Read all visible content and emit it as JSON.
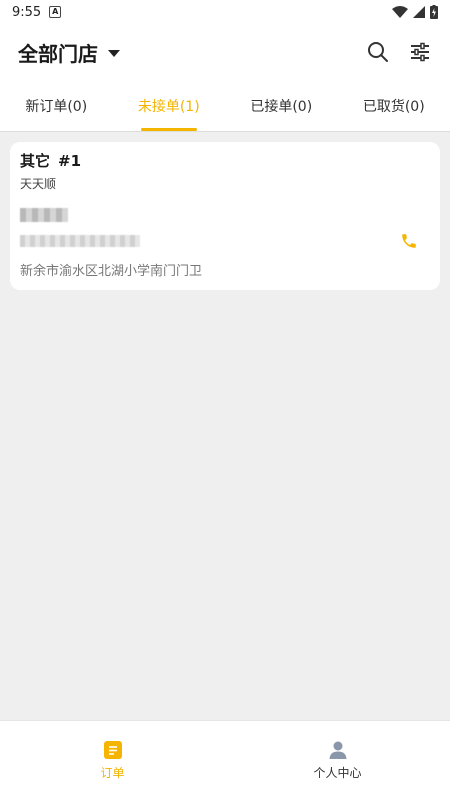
{
  "status_bar": {
    "time": "9:55",
    "a_badge": "A"
  },
  "header": {
    "title": "全部门店"
  },
  "tabs": [
    {
      "label": "新订单(0)",
      "active": false
    },
    {
      "label": "未接单(1)",
      "active": true
    },
    {
      "label": "已接单(0)",
      "active": false
    },
    {
      "label": "已取货(0)",
      "active": false
    }
  ],
  "order": {
    "title": "其它",
    "number": "#1",
    "subtitle": "天天顺",
    "address": "新余市渝水区北湖小学南门门卫"
  },
  "bottom_nav": [
    {
      "label": "订单",
      "icon": "order-icon",
      "active": true
    },
    {
      "label": "个人中心",
      "icon": "profile-icon",
      "active": false
    }
  ],
  "colors": {
    "accent": "#f4b400",
    "background": "#efefef",
    "card": "#ffffff"
  }
}
